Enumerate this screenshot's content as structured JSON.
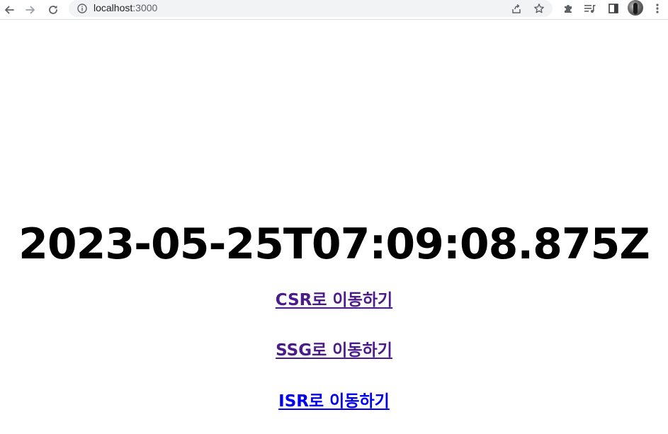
{
  "browser": {
    "url_host": "localhost",
    "url_port": ":3000",
    "icons": {
      "back": "arrow-left-icon",
      "forward": "arrow-right-icon",
      "reload": "reload-icon",
      "site_info": "info-circle-icon",
      "share": "share-icon",
      "bookmark": "star-icon",
      "extensions": "puzzle-icon",
      "media": "media-queue-icon",
      "side_panel": "side-panel-icon",
      "profile": "avatar",
      "menu": "kebab-menu-icon"
    }
  },
  "page": {
    "timestamp": "2023-05-25T07:09:08.875Z",
    "links": [
      {
        "label": "CSR로 이동하기",
        "state": "visited"
      },
      {
        "label": "SSG로 이동하기",
        "state": "visited"
      },
      {
        "label": "ISR로 이동하기",
        "state": "unvisited"
      }
    ]
  },
  "colors": {
    "visited_link": "#4b1b8c",
    "unvisited_link": "#0000ee",
    "text": "#000000",
    "omnibox_bg": "#f1f3f4"
  }
}
